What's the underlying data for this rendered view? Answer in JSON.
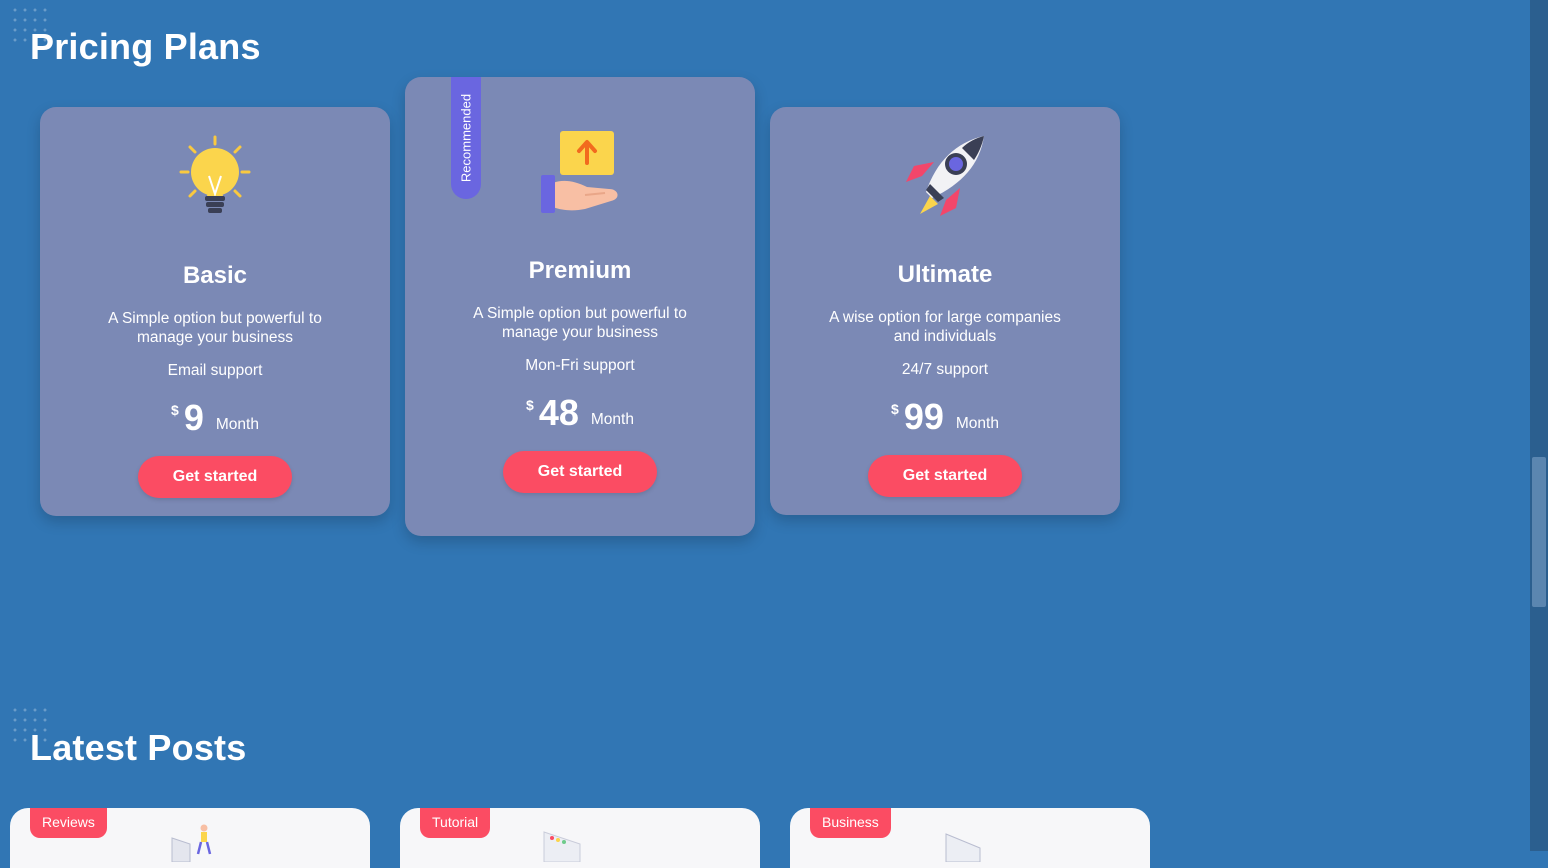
{
  "pricing": {
    "title": "Pricing Plans",
    "plans": [
      {
        "name": "Basic",
        "description": "A Simple option but powerful to manage your business",
        "support": "Email support",
        "currency": "$",
        "amount": "9",
        "period": "Month",
        "button": "Get started",
        "icon": "lightbulb-icon"
      },
      {
        "name": "Premium",
        "description": "A Simple option but powerful to manage your business",
        "support": "Mon-Fri support",
        "currency": "$",
        "amount": "48",
        "period": "Month",
        "button": "Get started",
        "icon": "hand-upload-icon",
        "badge": "Recommended"
      },
      {
        "name": "Ultimate",
        "description": "A wise option for large companies and individuals",
        "support": "24/7 support",
        "currency": "$",
        "amount": "99",
        "period": "Month",
        "button": "Get started",
        "icon": "rocket-icon"
      }
    ]
  },
  "posts": {
    "title": "Latest Posts",
    "items": [
      {
        "tag": "Reviews"
      },
      {
        "tag": "Tutorial"
      },
      {
        "tag": "Business"
      }
    ]
  },
  "colors": {
    "background": "#3176b4",
    "card": "#7b89b5",
    "accent": "#fb4c63",
    "ribbon": "#6a66e0"
  }
}
